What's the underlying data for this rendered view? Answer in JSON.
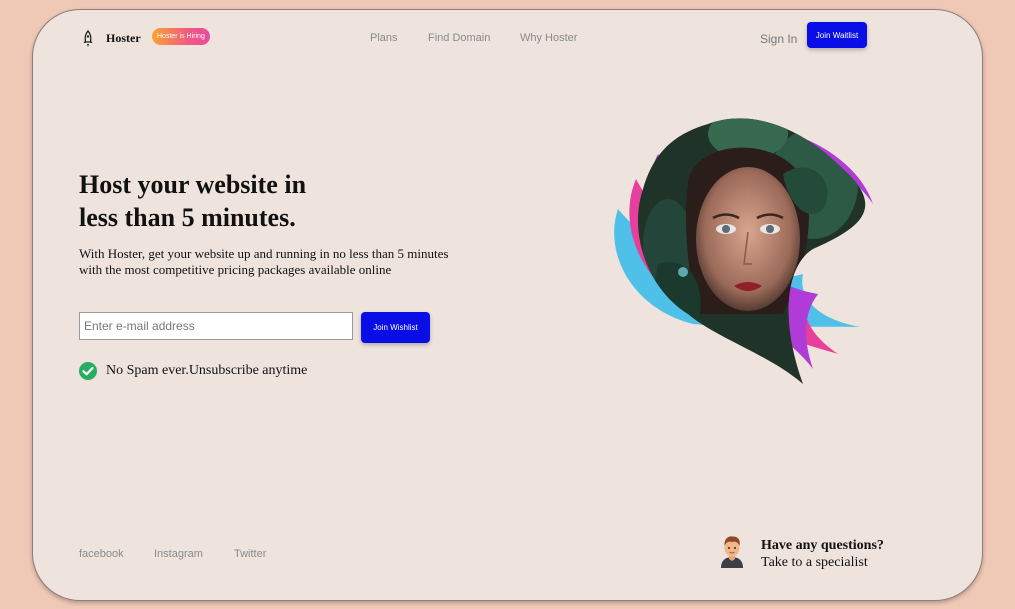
{
  "header": {
    "brand": "Hoster",
    "badge": "Hoster is Hiring",
    "nav": [
      "Plans",
      "Find Domain",
      "Why Hoster"
    ],
    "signin": "Sign In",
    "cta": "Join Waitlist"
  },
  "hero": {
    "title_line1": "Host your website in",
    "title_line2": "less than 5 minutes.",
    "subtitle": "With Hoster, get your website up and running in no less than 5 minutes with the most competitive pricing packages available online",
    "email_placeholder": "Enter e-mail address",
    "email_value": "",
    "submit": "Join Wishlist",
    "nospam": "No Spam ever.Unsubscribe anytime"
  },
  "footer": {
    "social": [
      "facebook",
      "Instagram",
      "Twitter"
    ],
    "help_title": "Have any questions?",
    "help_sub": "Take to a specialist"
  },
  "icons": {
    "logo": "rocket-icon",
    "check": "check-circle-icon",
    "avatar": "specialist-avatar-icon"
  },
  "colors": {
    "primary": "#0a0ee6",
    "background": "#efe3dd",
    "outer": "#f0c8b6",
    "check": "#27ae60",
    "badge_from": "#f6a531",
    "badge_to": "#e94aa0"
  }
}
